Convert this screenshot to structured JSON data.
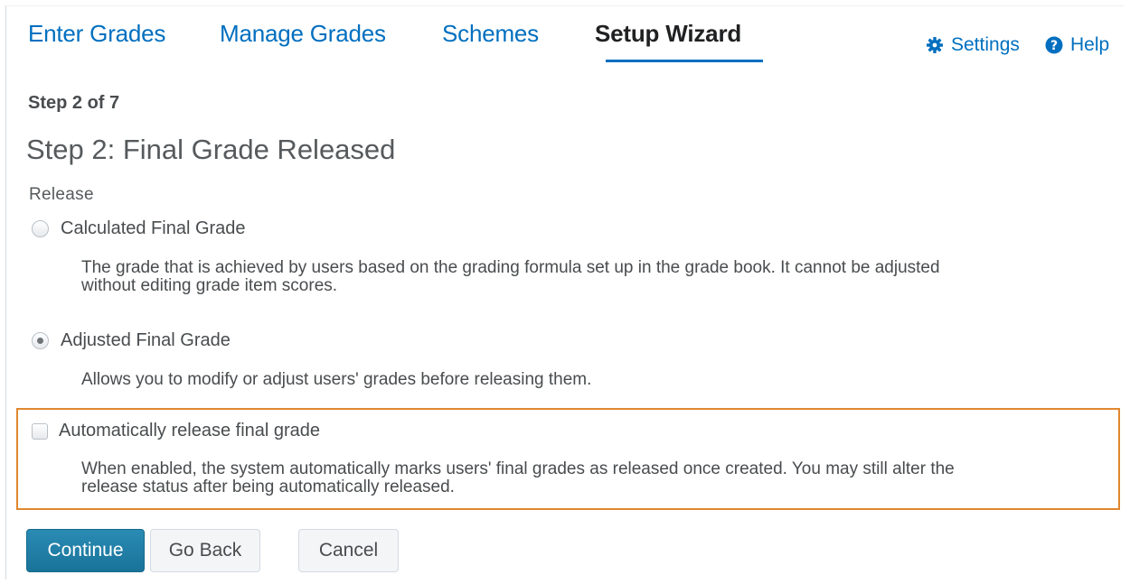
{
  "tabs": [
    {
      "label": "Enter Grades",
      "active": false
    },
    {
      "label": "Manage Grades",
      "active": false
    },
    {
      "label": "Schemes",
      "active": false
    },
    {
      "label": "Setup Wizard",
      "active": true
    }
  ],
  "tools": {
    "settings_label": "Settings",
    "settings_icon": "gear-icon",
    "help_label": "Help",
    "help_icon": "question-circle-icon"
  },
  "wizard": {
    "step_count": "Step 2 of 7",
    "title": "Step 2: Final Grade Released",
    "section_label": "Release"
  },
  "options": [
    {
      "label": "Calculated Final Grade",
      "selected": false,
      "description_lines": [
        "The grade that is achieved by users based on the grading formula set up in the grade book. It cannot be adjusted",
        "without editing grade item scores."
      ]
    },
    {
      "label": "Adjusted Final Grade",
      "selected": true,
      "description_lines": [
        "Allows you to modify or adjust users' grades before releasing them."
      ]
    }
  ],
  "auto_release": {
    "label": "Automatically release final grade",
    "checked": false,
    "description_lines": [
      "When enabled, the system automatically marks users' final grades as released once created. You may still alter the",
      "release status after being automatically released."
    ]
  },
  "buttons": {
    "continue": "Continue",
    "go_back": "Go Back",
    "cancel": "Cancel"
  },
  "colors": {
    "link": "#006fbf",
    "primary_button": "#1d7fa8",
    "highlight_border": "#e0872e"
  }
}
